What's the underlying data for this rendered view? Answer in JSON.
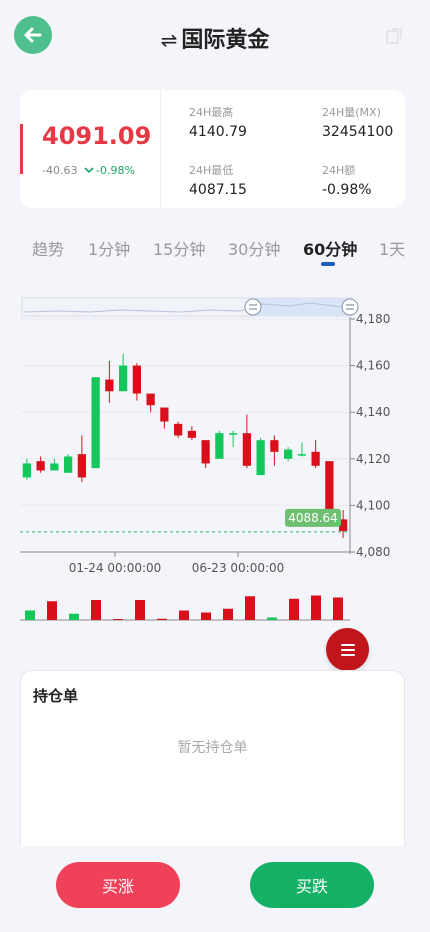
{
  "header": {
    "swap_symbol": "⇌",
    "title": "国际黄金",
    "back_icon": "back-arrow-icon",
    "share_icon": "share-icon"
  },
  "price": {
    "current": "4091.09",
    "change": "-40.63",
    "change_pct": "-0.98%",
    "direction_icon": "chevron-down-icon"
  },
  "stats": {
    "high_label": "24H最高",
    "high_value": "4140.79",
    "volume_label": "24H量(MX)",
    "volume_value": "32454100",
    "low_label": "24H最低",
    "low_value": "4087.15",
    "amount_label": "24H额",
    "amount_value": "-0.98%"
  },
  "tabs": [
    {
      "label": "趋势",
      "active": false
    },
    {
      "label": "1分钟",
      "active": false
    },
    {
      "label": "15分钟",
      "active": false
    },
    {
      "label": "30分钟",
      "active": false
    },
    {
      "label": "60分钟",
      "active": true
    },
    {
      "label": "1天",
      "active": false
    }
  ],
  "chart_data": {
    "type": "candlestick",
    "y_ticks": [
      "4,180",
      "4,160",
      "4,140",
      "4,120",
      "4,100",
      "4,080"
    ],
    "ylim": [
      4080,
      4180
    ],
    "x_ticks": [
      "01-24 00:00:00",
      "06-23 00:00:00"
    ],
    "last_price_label": "4088.64",
    "last_price": 4088.64,
    "colors": {
      "up": "#14c75a",
      "down": "#d9101b",
      "grid": "#e8e8ee"
    },
    "candles": [
      {
        "o": 4112,
        "h": 4120,
        "l": 4111,
        "c": 4118
      },
      {
        "o": 4119,
        "h": 4121,
        "l": 4114,
        "c": 4115
      },
      {
        "o": 4115,
        "h": 4120,
        "l": 4115,
        "c": 4118
      },
      {
        "o": 4114,
        "h": 4122,
        "l": 4114,
        "c": 4121
      },
      {
        "o": 4122,
        "h": 4130,
        "l": 4110,
        "c": 4112
      },
      {
        "o": 4116,
        "h": 4155,
        "l": 4116,
        "c": 4155
      },
      {
        "o": 4154,
        "h": 4162,
        "l": 4144,
        "c": 4149
      },
      {
        "o": 4149,
        "h": 4165,
        "l": 4149,
        "c": 4160
      },
      {
        "o": 4160,
        "h": 4161,
        "l": 4145,
        "c": 4148
      },
      {
        "o": 4148,
        "h": 4148,
        "l": 4140,
        "c": 4143
      },
      {
        "o": 4142,
        "h": 4142,
        "l": 4133,
        "c": 4136
      },
      {
        "o": 4135,
        "h": 4136,
        "l": 4129,
        "c": 4130
      },
      {
        "o": 4132,
        "h": 4134,
        "l": 4128,
        "c": 4129
      },
      {
        "o": 4128,
        "h": 4128,
        "l": 4116,
        "c": 4118
      },
      {
        "o": 4120,
        "h": 4132,
        "l": 4120,
        "c": 4131
      },
      {
        "o": 4131,
        "h": 4132,
        "l": 4125,
        "c": 4131
      },
      {
        "o": 4131,
        "h": 4139,
        "l": 4116,
        "c": 4117
      },
      {
        "o": 4113,
        "h": 4129,
        "l": 4113,
        "c": 4128
      },
      {
        "o": 4128,
        "h": 4130,
        "l": 4117,
        "c": 4123
      },
      {
        "o": 4120,
        "h": 4125,
        "l": 4119,
        "c": 4124
      },
      {
        "o": 4122,
        "h": 4127,
        "l": 4121,
        "c": 4122
      },
      {
        "o": 4123,
        "h": 4128,
        "l": 4116,
        "c": 4117
      },
      {
        "o": 4119,
        "h": 4119,
        "l": 4094,
        "c": 4096
      },
      {
        "o": 4094,
        "h": 4098,
        "l": 4086,
        "c": 4089
      }
    ],
    "volumes": [
      {
        "v": 0.38,
        "up": true
      },
      {
        "v": 0.75,
        "up": false
      },
      {
        "v": 0.25,
        "up": true
      },
      {
        "v": 0.8,
        "up": false
      },
      {
        "v": 0.0,
        "up": false
      },
      {
        "v": 0.8,
        "up": false
      },
      {
        "v": 0.05,
        "up": false
      },
      {
        "v": 0.38,
        "up": false
      },
      {
        "v": 0.3,
        "up": false
      },
      {
        "v": 0.45,
        "up": false
      },
      {
        "v": 0.95,
        "up": false
      },
      {
        "v": 0.1,
        "up": true
      },
      {
        "v": 0.85,
        "up": false
      },
      {
        "v": 0.98,
        "up": false
      },
      {
        "v": 0.9,
        "up": false
      }
    ]
  },
  "positions": {
    "title": "持仓单",
    "empty_text": "暂无持仓单"
  },
  "footer": {
    "buy_up_label": "买涨",
    "buy_down_label": "买跌"
  }
}
